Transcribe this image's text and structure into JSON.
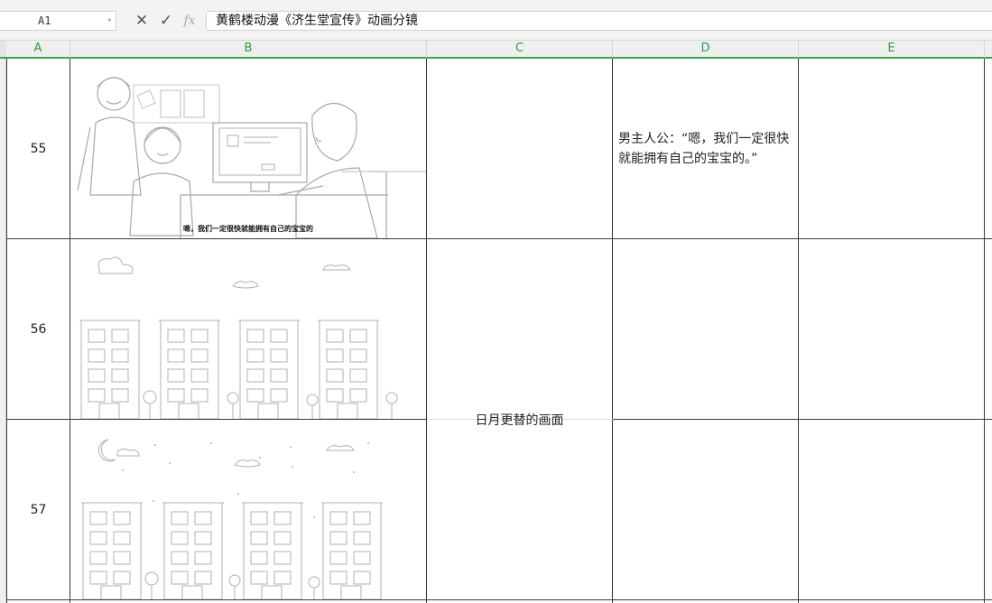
{
  "formula_bar": {
    "name_box": "A1",
    "cancel_icon": "close-icon",
    "confirm_icon": "check-icon",
    "fx_label": "fx",
    "content": "黄鹤楼动漫《济生堂宣传》动画分镜"
  },
  "columns": [
    "A",
    "B",
    "C",
    "D",
    "E"
  ],
  "rows": [
    {
      "number": "55",
      "scene_caption": "嗯，我们一定很快就能拥有自己的宝宝的",
      "c": "",
      "d": "男主人公：“嗯，我们一定很快就能拥有自己的宝宝的。”",
      "e": ""
    },
    {
      "number": "56",
      "c": "",
      "d": "",
      "e": ""
    },
    {
      "number": "57",
      "c": "",
      "d": "",
      "e": ""
    }
  ],
  "merged_c_56_57": "日月更替的画面",
  "colors": {
    "header_accent": "#2f9c3e",
    "grid_line": "#3a3a3a"
  }
}
